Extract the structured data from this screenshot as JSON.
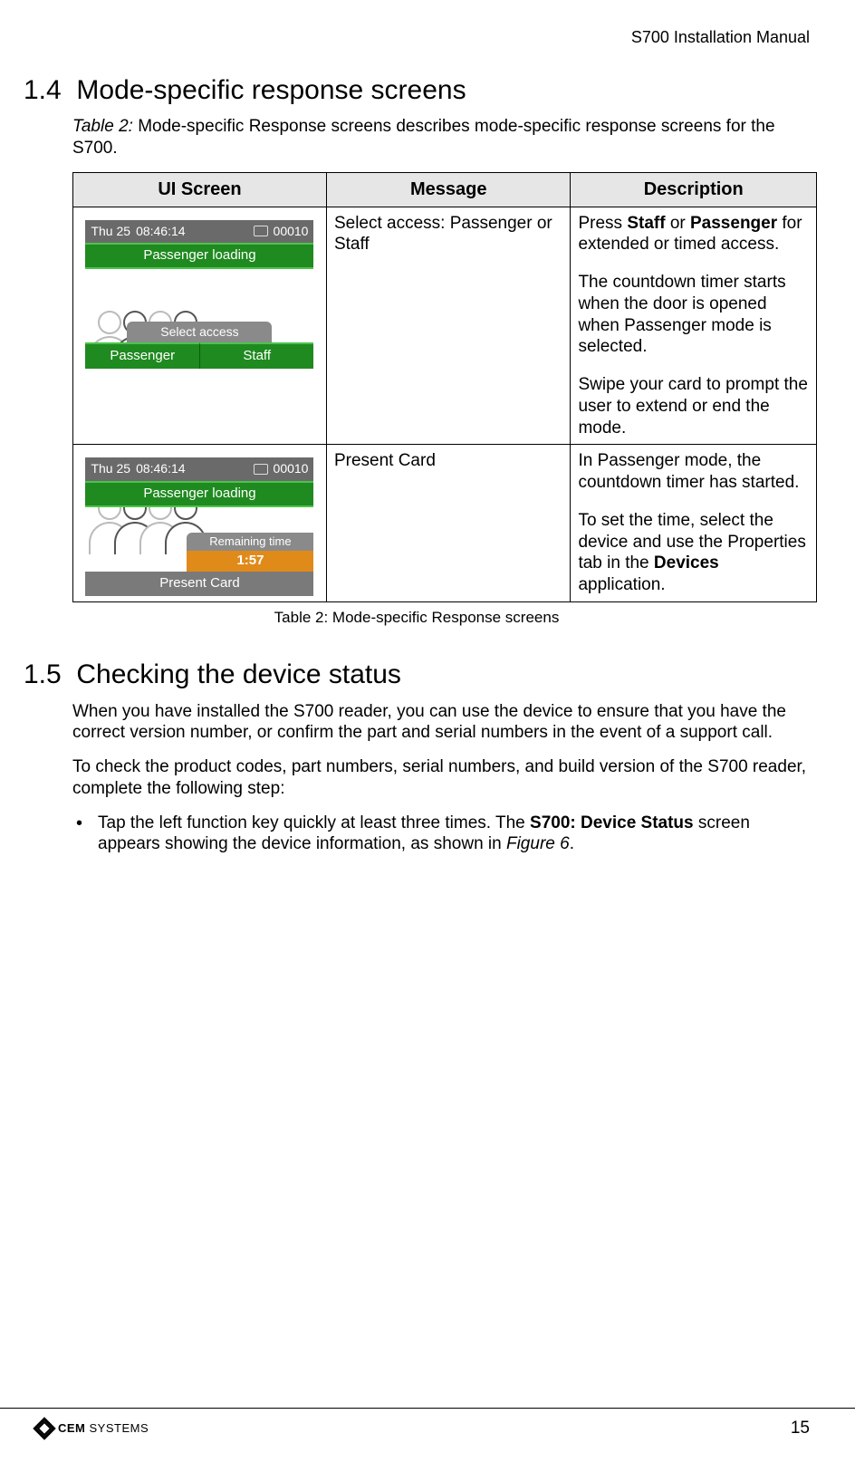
{
  "header": {
    "running": "S700 Installation Manual"
  },
  "section14": {
    "number": "1.4",
    "title": "Mode-specific response screens",
    "intro_prefix": "Table 2:",
    "intro_rest": " Mode-specific Response screens describes mode-specific response screens for the S700."
  },
  "table2": {
    "headers": {
      "ui": "UI Screen",
      "msg": "Message",
      "desc": "Description"
    },
    "caption": "Table 2: Mode-specific Response screens",
    "rows": [
      {
        "ui": {
          "date": "Thu 25",
          "time": "08:46:14",
          "counter": "00010",
          "greenbar": "Passenger loading",
          "select_label": "Select access",
          "btn_left": "Passenger",
          "btn_right": "Staff"
        },
        "message": "Select access: Passenger or Staff",
        "desc": {
          "p1_a": "Press ",
          "p1_b": "Staff",
          "p1_c": " or ",
          "p1_d": "Passenger",
          "p1_e": " for extended or timed access.",
          "p2": "The countdown timer starts when the door is opened when Passenger mode is selected.",
          "p3": "Swipe your card to prompt the user to extend or end the mode."
        }
      },
      {
        "ui": {
          "date": "Thu 25",
          "time": "08:46:14",
          "counter": "00010",
          "greenbar": "Passenger loading",
          "timer_label": "Remaining time",
          "timer_value": "1:57",
          "present": "Present Card"
        },
        "message": "Present Card",
        "desc": {
          "p1": "In Passenger mode, the countdown timer has started.",
          "p2_a": "To set the time, select the device and use the Properties tab in the ",
          "p2_b": "Devices",
          "p2_c": " application."
        }
      }
    ]
  },
  "section15": {
    "number": "1.5",
    "title": "Checking the device status",
    "p1": "When you have installed the S700 reader, you can use the device to ensure that you have the correct version number, or confirm the part and serial numbers in the event of a support call.",
    "p2": "To check the product codes, part numbers, serial numbers, and build version of the S700 reader, complete the following step:",
    "bullet": {
      "a": "Tap the left function key quickly at least three times. The ",
      "b": "S700: Device Status",
      "c": " screen appears showing the device information, as shown in ",
      "d": "Figure 6",
      "e": "."
    }
  },
  "footer": {
    "brand_a": "CEM",
    "brand_b": "SYSTEMS",
    "page": "15"
  }
}
